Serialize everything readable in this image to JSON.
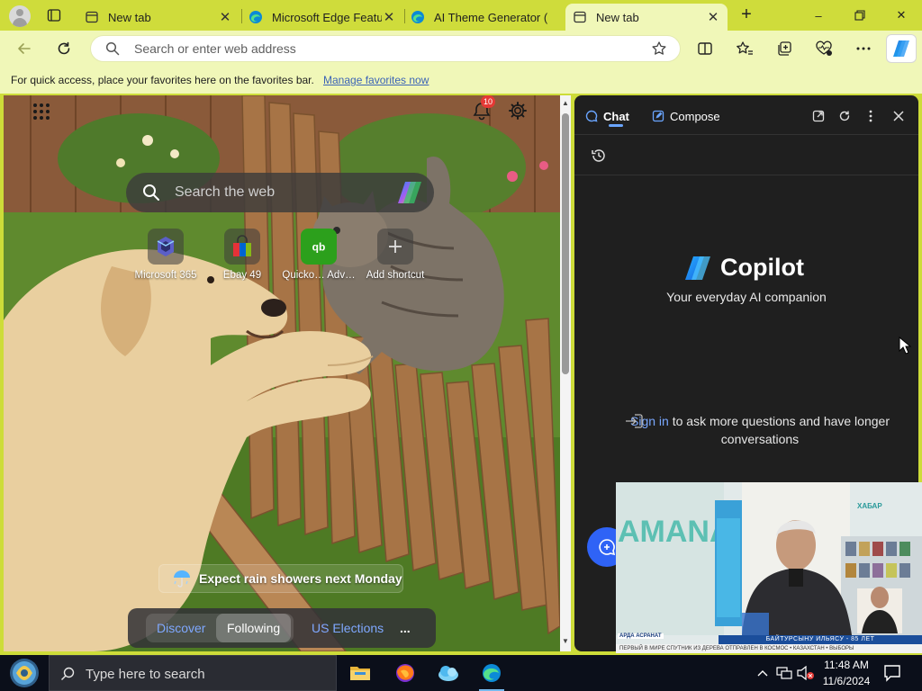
{
  "tabs": [
    {
      "label": "New tab",
      "icon": "newtab-icon",
      "active": false
    },
    {
      "label": "Microsoft Edge Features",
      "icon": "edge-icon",
      "active": false
    },
    {
      "label": "AI Theme Generator (",
      "icon": "edge-icon",
      "active": false
    },
    {
      "label": "New tab",
      "icon": "newtab-icon",
      "active": true
    }
  ],
  "window": {
    "new_tab": "+",
    "minimize": "–",
    "restore": "❐",
    "close": "✕"
  },
  "address": {
    "placeholder": "Search or enter web address",
    "value": ""
  },
  "favorites_bar": {
    "message": "For quick access, place your favorites here on the favorites bar.",
    "link": "Manage favorites now"
  },
  "ntp": {
    "notification_count": "10",
    "search_placeholder": "Search the web",
    "shortcuts": [
      {
        "label": "Microsoft 365",
        "icon": "microsoft365-icon"
      },
      {
        "label": "Ebay 49",
        "icon": "ebay-bag-icon"
      },
      {
        "label": "Quicko…  Adv…",
        "icon": "quickbooks-icon"
      },
      {
        "label": "Add shortcut",
        "icon": "plus-icon"
      }
    ],
    "weather": {
      "text": "Expect rain showers next Monday",
      "icon": "umbrella-icon"
    },
    "feed_tabs": [
      "Discover",
      "Following",
      "US Elections",
      "..."
    ]
  },
  "copilot": {
    "tab_chat": "Chat",
    "tab_compose": "Compose",
    "brand": "Copilot",
    "tagline": "Your everyday AI companion",
    "signin_link": "Sign in",
    "signin_rest": " to ask more questions and have longer conversations"
  },
  "video": {
    "caption": "БАЙТУРСЫНУ ИЛЬЯСУ - 85 ЛЕТ",
    "station": "АРДА АСРАНАТ",
    "ticker": "ПЕРВЫЙ В МИРЕ СПУТНИК ИЗ ДЕРЕВА ОТПРАВЛЕН В КОСМОС  •  КАЗАХСТАН  •  ВЫБОРЫ",
    "wall_text": "AMANAT",
    "logo": "ХАБАР"
  },
  "taskbar": {
    "search_placeholder": "Type here to search",
    "time": "11:48 AM",
    "date": "11/6/2024",
    "apps": [
      "file-explorer-icon",
      "firefox-icon",
      "weather-app-icon",
      "edge-icon"
    ]
  },
  "colors": {
    "theme": "#cfdc3b",
    "toolbar": "#f0f7b8",
    "sidebar_bg": "#1f1f1f",
    "link": "#3b63b6",
    "copilot_link": "#79a7ff",
    "taskbar": "#0b0f1a"
  }
}
